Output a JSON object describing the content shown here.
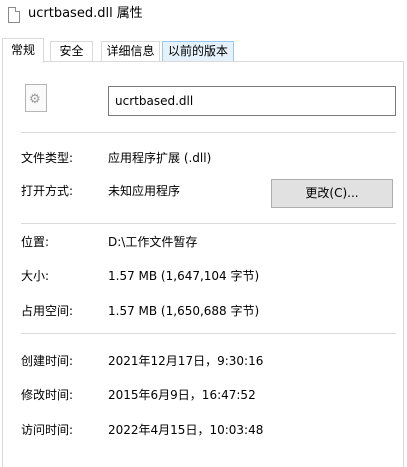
{
  "window": {
    "title": "ucrtbased.dll 属性"
  },
  "tabs": [
    {
      "label": "常规",
      "active": true
    },
    {
      "label": "安全",
      "active": false
    },
    {
      "label": "详细信息",
      "active": false
    },
    {
      "label": "以前的版本",
      "active": false
    }
  ],
  "general": {
    "file_name": "ucrtbased.dll",
    "file_icon": "dll-gear-file-icon",
    "file_type_label": "文件类型:",
    "file_type_value": "应用程序扩展 (.dll)",
    "opens_with_label": "打开方式:",
    "opens_with_value": "未知应用程序",
    "change_button": "更改(C)...",
    "location_label": "位置:",
    "location_value": "D:\\工作文件暂存",
    "size_label": "大小:",
    "size_value": "1.57 MB (1,647,104 字节)",
    "size_on_disk_label": "占用空间:",
    "size_on_disk_value": "1.57 MB (1,650,688 字节)",
    "created_label": "创建时间:",
    "created_value": "2021年12月17日，9:30:16",
    "modified_label": "修改时间:",
    "modified_value": "2015年6月9日，16:47:52",
    "accessed_label": "访问时间:",
    "accessed_value": "2022年4月15日，10:03:48"
  }
}
